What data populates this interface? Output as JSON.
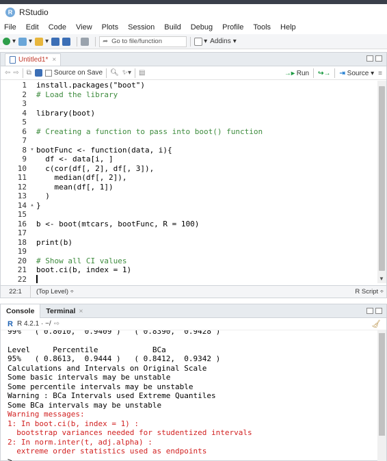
{
  "app": {
    "title": "RStudio",
    "logo_letter": "R"
  },
  "menu": [
    "File",
    "Edit",
    "Code",
    "View",
    "Plots",
    "Session",
    "Build",
    "Debug",
    "Profile",
    "Tools",
    "Help"
  ],
  "toolbar": {
    "goto_placeholder": "Go to file/function",
    "addins_label": "Addins"
  },
  "editor": {
    "tab_label": "Untitled1*",
    "source_on_save_label": "Source on Save",
    "run_label": "Run",
    "source_label": "Source",
    "lines": [
      {
        "n": "1",
        "fold": "",
        "text": "install.packages(\"boot\")"
      },
      {
        "n": "2",
        "fold": "",
        "text": "# Load the library"
      },
      {
        "n": "3",
        "fold": "",
        "text": ""
      },
      {
        "n": "4",
        "fold": "",
        "text": "library(boot)"
      },
      {
        "n": "5",
        "fold": "",
        "text": ""
      },
      {
        "n": "6",
        "fold": "",
        "text": "# Creating a function to pass into boot() function"
      },
      {
        "n": "7",
        "fold": "",
        "text": ""
      },
      {
        "n": "8",
        "fold": "▾",
        "text": "bootFunc <- function(data, i){"
      },
      {
        "n": "9",
        "fold": "",
        "text": "  df <- data[i, ]"
      },
      {
        "n": "10",
        "fold": "",
        "text": "  c(cor(df[, 2], df[, 3]),"
      },
      {
        "n": "11",
        "fold": "",
        "text": "    median(df[, 2]),"
      },
      {
        "n": "12",
        "fold": "",
        "text": "    mean(df[, 1])"
      },
      {
        "n": "13",
        "fold": "",
        "text": "  )"
      },
      {
        "n": "14",
        "fold": "▴",
        "text": "}"
      },
      {
        "n": "15",
        "fold": "",
        "text": ""
      },
      {
        "n": "16",
        "fold": "",
        "text": "b <- boot(mtcars, bootFunc, R = 100)"
      },
      {
        "n": "17",
        "fold": "",
        "text": ""
      },
      {
        "n": "18",
        "fold": "",
        "text": "print(b)"
      },
      {
        "n": "19",
        "fold": "",
        "text": ""
      },
      {
        "n": "20",
        "fold": "",
        "text": "# Show all CI values"
      },
      {
        "n": "21",
        "fold": "",
        "text": "boot.ci(b, index = 1)"
      },
      {
        "n": "22",
        "fold": "",
        "text": ""
      }
    ],
    "status_position": "22:1",
    "status_level": "(Top Level) ÷",
    "status_filetype": "R Script ÷"
  },
  "console": {
    "tab_console": "Console",
    "tab_terminal": "Terminal",
    "r_version": "R 4.2.1 · ~/",
    "cut_line": "99%   ( 0.8010,  0.9409 )   ( 0.8390,  0.9428 )",
    "lines": [
      {
        "text": "",
        "err": false
      },
      {
        "text": "Level     Percentile            BCa",
        "err": false
      },
      {
        "text": "95%   ( 0.8613,  0.9444 )   ( 0.8412,  0.9342 )",
        "err": false
      },
      {
        "text": "Calculations and Intervals on Original Scale",
        "err": false
      },
      {
        "text": "Some basic intervals may be unstable",
        "err": false
      },
      {
        "text": "Some percentile intervals may be unstable",
        "err": false
      },
      {
        "text": "Warning : BCa Intervals used Extreme Quantiles",
        "err": false
      },
      {
        "text": "Some BCa intervals may be unstable",
        "err": false
      },
      {
        "text": "Warning messages:",
        "err": true
      },
      {
        "text": "1: In boot.ci(b, index = 1) :",
        "err": true
      },
      {
        "text": "  bootstrap variances needed for studentized intervals",
        "err": true
      },
      {
        "text": "2: In norm.inter(t, adj.alpha) :",
        "err": true
      },
      {
        "text": "  extreme order statistics used as endpoints",
        "err": true
      },
      {
        "text": ">",
        "err": false
      }
    ]
  }
}
